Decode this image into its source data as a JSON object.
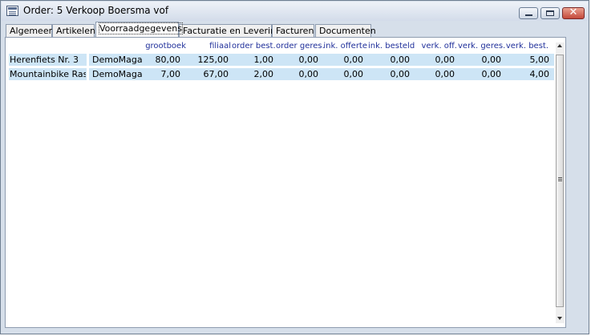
{
  "window": {
    "title": "Order: 5 Verkoop Boersma vof",
    "icon": "form-icon"
  },
  "tabs": [
    {
      "label": "Algemeen",
      "active": false
    },
    {
      "label": "Artikelen",
      "active": false
    },
    {
      "label": "Voorraadgegevens",
      "active": true
    },
    {
      "label": "Facturatie en Levering",
      "active": false
    },
    {
      "label": "Facturen",
      "active": false
    },
    {
      "label": "Documenten",
      "active": false
    }
  ],
  "columns": [
    "grootboek",
    "filiaal",
    "order best.",
    "order geres.",
    "ink. offerte",
    "ink. besteld",
    "verk. off.",
    "verk. geres.",
    "verk. best."
  ],
  "rows": [
    {
      "article": "Herenfiets Nr. 3",
      "location": "DemoMaga",
      "values": [
        "80,00",
        "125,00",
        "1,00",
        "0,00",
        "0,00",
        "0,00",
        "0,00",
        "0,00",
        "5,00"
      ]
    },
    {
      "article": "Mountainbike Rasm",
      "location": "DemoMaga",
      "values": [
        "7,00",
        "67,00",
        "2,00",
        "0,00",
        "0,00",
        "0,00",
        "0,00",
        "0,00",
        "4,00"
      ]
    }
  ],
  "colors": {
    "header_text": "#1f2f9a",
    "row_highlight": "#cde5f6",
    "frame": "#d6dfea"
  }
}
